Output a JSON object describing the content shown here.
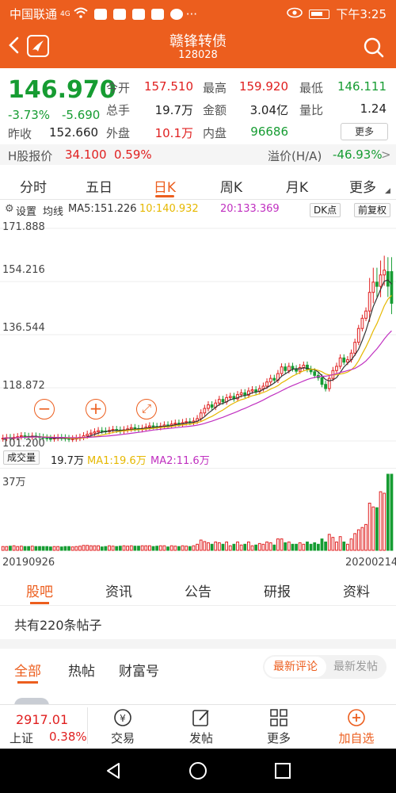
{
  "status": {
    "carrier": "中国联通",
    "network": "4G",
    "time": "下午3:25",
    "more": "···"
  },
  "header": {
    "title": "赣锋转债",
    "code": "128028"
  },
  "quote": {
    "price": "146.970",
    "change_pct": "-3.73%",
    "change": "-5.690",
    "prev_close_label": "昨收",
    "prev_close": "152.660",
    "fields": [
      {
        "label": "今开",
        "value": "157.510",
        "color": "red"
      },
      {
        "label": "最高",
        "value": "159.920",
        "color": "red"
      },
      {
        "label": "最低",
        "value": "146.111",
        "color": "green"
      },
      {
        "label": "总手",
        "value": "19.7万",
        "color": "dark"
      },
      {
        "label": "金额",
        "value": "3.04亿",
        "color": "dark"
      },
      {
        "label": "量比",
        "value": "1.24",
        "color": "dark"
      },
      {
        "label": "外盘",
        "value": "10.1万",
        "color": "red"
      },
      {
        "label": "内盘",
        "value": "96686",
        "color": "green"
      }
    ],
    "more_btn": "更多",
    "h_label": "H股报价",
    "h_price": "34.100",
    "h_pct": "0.59%",
    "premium_label": "溢价(H/A)",
    "premium": "-46.93%",
    "premium_arrow": ">"
  },
  "period_tabs": [
    "分时",
    "五日",
    "日K",
    "周K",
    "月K",
    "更多"
  ],
  "period_active": 2,
  "ma_row": {
    "settings": "设置",
    "label": "均线",
    "ma5": "MA5:151.226",
    "ma10": "10:140.932",
    "ma20": "20:133.369",
    "dk": "DK点",
    "adjust": "前复权"
  },
  "chart_data": {
    "type": "candlestick",
    "ylim": [
      101.2,
      171.888
    ],
    "y_ticks": [
      "171.888",
      "154.216",
      "136.544",
      "118.872",
      "101.200"
    ],
    "x_labels": [
      "20190926",
      "20200214"
    ],
    "closes": [
      102.1,
      102.3,
      102.0,
      102.4,
      102.6,
      102.9,
      102.7,
      102.5,
      102.8,
      102.6,
      102.4,
      102.2,
      102.0,
      101.9,
      102.1,
      102.3,
      102.2,
      102.0,
      101.8,
      101.9,
      102.1,
      102.4,
      102.9,
      103.4,
      103.8,
      104.2,
      104.6,
      104.5,
      104.3,
      104.7,
      105.0,
      104.8,
      104.5,
      104.9,
      105.2,
      105.6,
      105.3,
      105.0,
      105.4,
      105.8,
      106.2,
      106.0,
      105.7,
      106.1,
      106.5,
      106.4,
      106.8,
      107.1,
      106.9,
      107.3,
      107.6,
      107.4,
      107.8,
      108.6,
      110.5,
      112.0,
      113.2,
      112.4,
      113.8,
      115.0,
      114.2,
      115.6,
      116.0,
      115.2,
      116.6,
      117.2,
      116.4,
      117.8,
      118.2,
      117.6,
      118.6,
      119.4,
      120.8,
      122.0,
      121.4,
      123.6,
      125.8,
      124.6,
      126.0,
      125.2,
      124.4,
      125.6,
      126.4,
      125.0,
      124.2,
      123.0,
      122.2,
      120.0,
      118.6,
      122.0,
      124.6,
      126.0,
      128.8,
      127.4,
      128.2,
      130.4,
      134.0,
      138.6,
      142.0,
      144.4,
      150.6,
      154.0,
      152.6,
      156.4,
      158.0,
      152.66,
      146.97
    ],
    "opens": [
      101.9,
      102.1,
      102.3,
      102.0,
      102.4,
      102.6,
      102.9,
      102.7,
      102.5,
      102.8,
      102.6,
      102.4,
      102.2,
      102.0,
      101.9,
      102.1,
      102.3,
      102.2,
      102.0,
      101.8,
      101.9,
      102.1,
      102.4,
      102.9,
      103.4,
      103.8,
      104.2,
      104.6,
      104.5,
      104.3,
      104.7,
      105.0,
      104.8,
      104.5,
      104.9,
      105.2,
      105.6,
      105.3,
      105.0,
      105.4,
      105.8,
      106.2,
      106.0,
      105.7,
      106.1,
      106.5,
      106.4,
      106.8,
      107.1,
      106.9,
      107.3,
      107.6,
      107.4,
      107.8,
      108.6,
      110.5,
      112.0,
      113.2,
      112.4,
      113.8,
      115.0,
      114.2,
      115.6,
      116.0,
      115.2,
      116.6,
      117.2,
      116.4,
      117.8,
      118.2,
      117.6,
      118.6,
      119.4,
      120.8,
      122.0,
      121.4,
      123.6,
      125.8,
      124.6,
      126.0,
      125.2,
      124.4,
      125.6,
      126.4,
      125.0,
      124.2,
      123.0,
      122.2,
      120.0,
      118.6,
      122.0,
      124.6,
      126.0,
      128.8,
      127.4,
      128.2,
      130.4,
      134.0,
      138.6,
      142.0,
      144.4,
      150.6,
      154.0,
      152.6,
      156.4,
      157.51,
      157.51
    ],
    "highs_extra": 1.2,
    "ma5_color": "#333333",
    "ma10_color": "#e6b800",
    "ma20_color": "#c030c0",
    "up_color": "#e02020",
    "down_color": "#169c32"
  },
  "volume": {
    "label": "成交量",
    "value": "19.7万",
    "ma1": "MA1:19.6万",
    "ma2": "MA2:11.6万",
    "max_label": "37万"
  },
  "section_tabs": [
    "股吧",
    "资讯",
    "公告",
    "研报",
    "资料"
  ],
  "section_active": 0,
  "posts_count": "共有220条帖子",
  "filter_tabs": [
    "全部",
    "热帖",
    "财富号"
  ],
  "sort_options": [
    "最新评论",
    "最新发帖"
  ],
  "bottom_bar": {
    "index_value": "2917.01",
    "index_name": "上证",
    "index_pct": "0.38%",
    "items": [
      "交易",
      "发帖",
      "更多",
      "加自选"
    ]
  }
}
